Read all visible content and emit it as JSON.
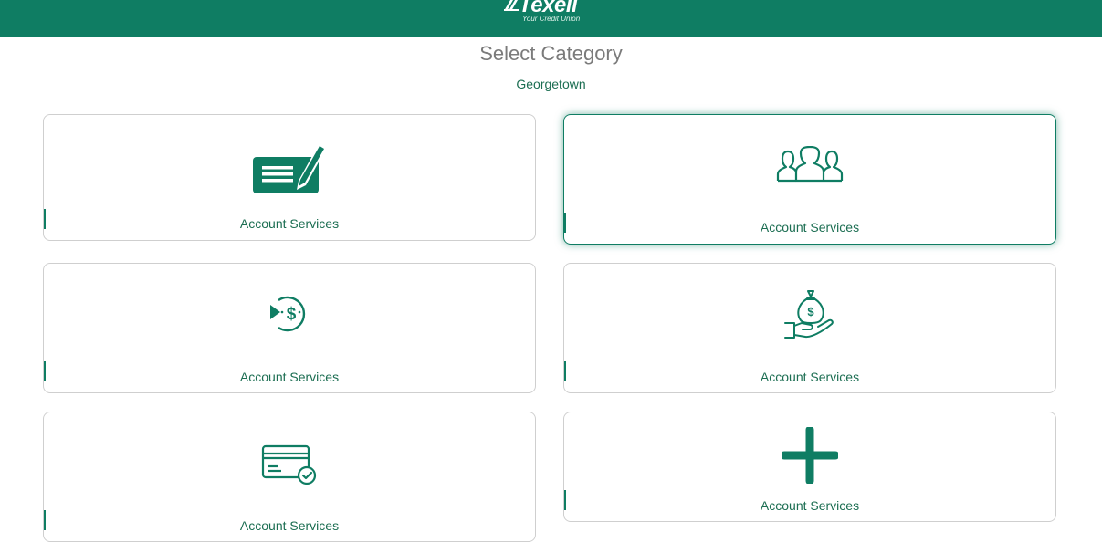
{
  "header": {
    "logo_text": "Texell",
    "logo_tagline": "Your Credit Union",
    "brand_color": "#0f7d63"
  },
  "page": {
    "title": "Select Category",
    "location": "Georgetown"
  },
  "categories": [
    {
      "label": "Account Services",
      "icon": "check-writing-icon",
      "selected": false
    },
    {
      "label": "Account Services",
      "icon": "people-group-icon",
      "selected": true
    },
    {
      "label": "Account Services",
      "icon": "dollar-exchange-icon",
      "selected": false
    },
    {
      "label": "Account Services",
      "icon": "money-bag-hand-icon",
      "selected": false
    },
    {
      "label": "Account Services",
      "icon": "credit-card-check-icon",
      "selected": false
    },
    {
      "label": "Account Services",
      "icon": "plus-icon",
      "selected": false
    }
  ]
}
